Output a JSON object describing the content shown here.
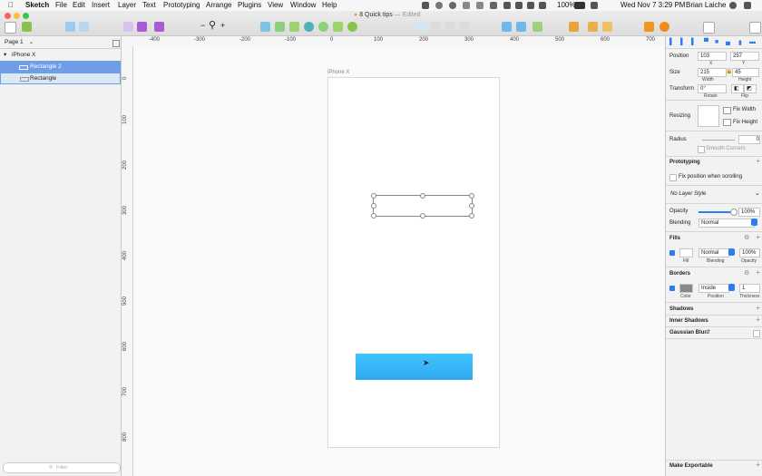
{
  "menubar": {
    "app": "Sketch",
    "items": [
      "File",
      "Edit",
      "Insert",
      "Layer",
      "Text",
      "Prototyping",
      "Arrange",
      "Plugins",
      "View",
      "Window",
      "Help"
    ],
    "battery": "100%",
    "datetime": "Wed Nov 7  3:29 PM",
    "user": "Brian Laiche"
  },
  "window": {
    "title": "8 Quick tips",
    "status": "— Edited"
  },
  "leftpanel": {
    "page": "Page 1",
    "artboard": "iPhone X",
    "layers": [
      "Rectangle 2",
      "Rectangle"
    ],
    "filter_placeholder": "Filter"
  },
  "rulers": {
    "h": [
      "-400",
      "-300",
      "-200",
      "-100",
      "0",
      "100",
      "200",
      "300",
      "400",
      "500",
      "600",
      "700"
    ],
    "v": [
      "0",
      "100",
      "200",
      "300",
      "400",
      "500",
      "600",
      "700",
      "800"
    ]
  },
  "canvas": {
    "artboard_label": "iPhone X"
  },
  "inspector": {
    "position": {
      "label": "Position",
      "x": "103",
      "y": "257",
      "x_label": "X",
      "y_label": "Y"
    },
    "size": {
      "label": "Size",
      "w": "215",
      "h": "45",
      "w_label": "Width",
      "h_label": "Height"
    },
    "transform": {
      "label": "Transform",
      "rotate": "0°",
      "rotate_label": "Rotate",
      "flip_label": "Flip"
    },
    "resizing": {
      "label": "Resizing",
      "fix_width": "Fix Width",
      "fix_height": "Fix Height"
    },
    "radius": {
      "label": "Radius",
      "value": "0",
      "smooth": "Smooth Corners"
    },
    "prototyping": {
      "label": "Prototyping",
      "fix_scroll": "Fix position when scrolling"
    },
    "layer_style": "No Layer Style",
    "opacity": {
      "label": "Opacity",
      "value": "100%"
    },
    "blending": {
      "label": "Blending",
      "value": "Normal"
    },
    "fills": {
      "label": "Fills",
      "blend": "Normal",
      "opacity": "100%",
      "fill_label": "Fill",
      "blend_label": "Blending",
      "opacity_label": "Opacity"
    },
    "borders": {
      "label": "Borders",
      "position": "Inside",
      "thickness": "1",
      "color_label": "Color",
      "position_label": "Position",
      "thickness_label": "Thickness"
    },
    "shadows": "Shadows",
    "inner_shadows": "Inner Shadows",
    "blur": "Gaussian Blur",
    "export": "Make Exportable"
  },
  "colors": {
    "accent": "#2d7cf0",
    "selected_layer": "#6e9ee8",
    "blue_rect": "#3bb9fb"
  }
}
